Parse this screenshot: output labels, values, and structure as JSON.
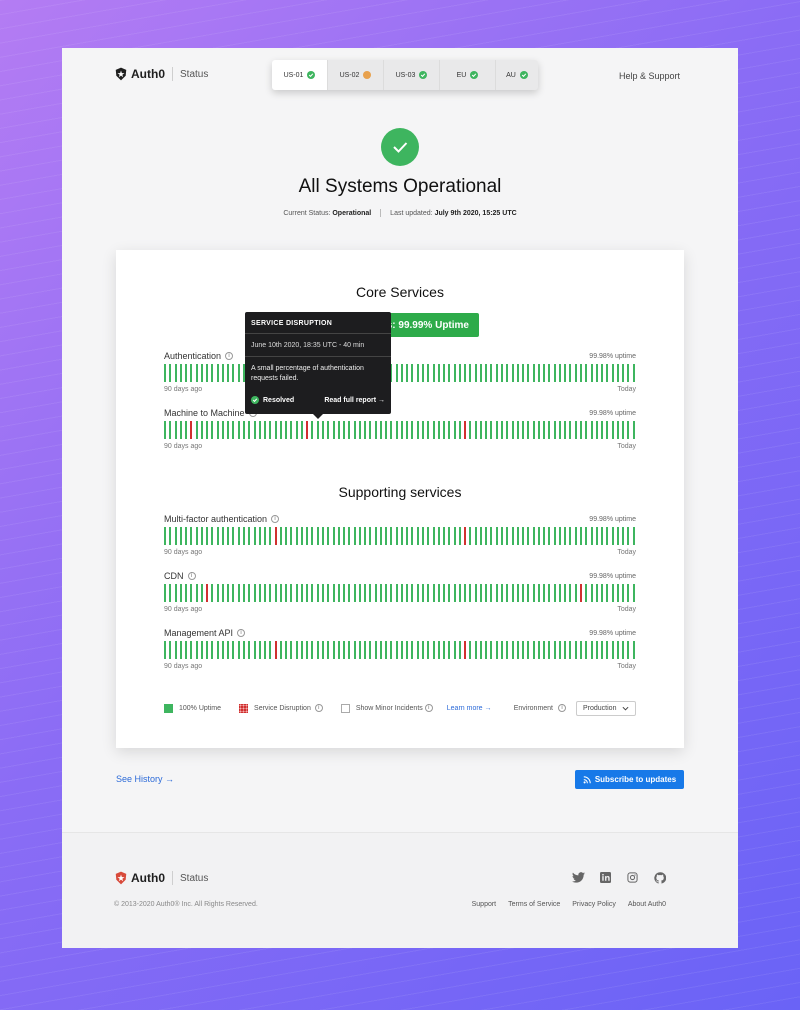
{
  "brand": {
    "name": "Auth0",
    "section": "Status"
  },
  "regions": [
    {
      "label": "US-01",
      "status": "ok"
    },
    {
      "label": "US-02",
      "status": "warn"
    },
    {
      "label": "US-03",
      "status": "ok"
    },
    {
      "label": "EU",
      "status": "ok"
    },
    {
      "label": "AU",
      "status": "ok"
    }
  ],
  "help_link": "Help & Support",
  "hero": {
    "title": "All Systems Operational",
    "status_label": "Current Status:",
    "status_value": "Operational",
    "updated_label": "Last updated:",
    "updated_value": "July 9th 2020, 15:25 UTC"
  },
  "core": {
    "title": "Core Services",
    "uptime_badge": "s: 99.99% Uptime",
    "services": [
      {
        "name": "Authentication",
        "uptime": "99.98% uptime",
        "from": "90 days ago",
        "to": "Today",
        "disruptions": []
      },
      {
        "name": "Machine to Machine",
        "uptime": "99.98% uptime",
        "from": "90 days ago",
        "to": "Today",
        "disruptions": [
          5,
          27,
          57
        ]
      }
    ]
  },
  "supporting": {
    "title": "Supporting services",
    "services": [
      {
        "name": "Multi-factor authentication",
        "uptime": "99.98% uptime",
        "from": "90 days ago",
        "to": "Today",
        "disruptions": [
          21,
          57
        ]
      },
      {
        "name": "CDN",
        "uptime": "99.98% uptime",
        "from": "90 days ago",
        "to": "Today",
        "disruptions": [
          8,
          79
        ]
      },
      {
        "name": "Management API",
        "uptime": "99.98% uptime",
        "from": "90 days ago",
        "to": "Today",
        "disruptions": [
          21,
          57
        ]
      }
    ]
  },
  "tooltip": {
    "title": "SERVICE DISRUPTION",
    "time": "June 10th 2020, 18:35 UTC - 40 min",
    "description": "A small percentage of authentication requests failed.",
    "status": "Resolved",
    "link": "Read full report →"
  },
  "legend": {
    "uptime": "100% Uptime",
    "disruption": "Service Disruption",
    "minor": "Show Minor Incidents",
    "learn_more": "Learn more →",
    "environment_label": "Environment",
    "environment_value": "Production"
  },
  "history_link": "See History →",
  "subscribe": "Subscribe to updates",
  "footer": {
    "copyright": "© 2013-2020 Auth0® Inc. All Rights Reserved.",
    "links": [
      "Support",
      "Terms of Service",
      "Privacy Policy",
      "About Auth0"
    ]
  },
  "colors": {
    "green": "#3eb55f",
    "red": "#d0302f",
    "blue": "#1779e8"
  }
}
